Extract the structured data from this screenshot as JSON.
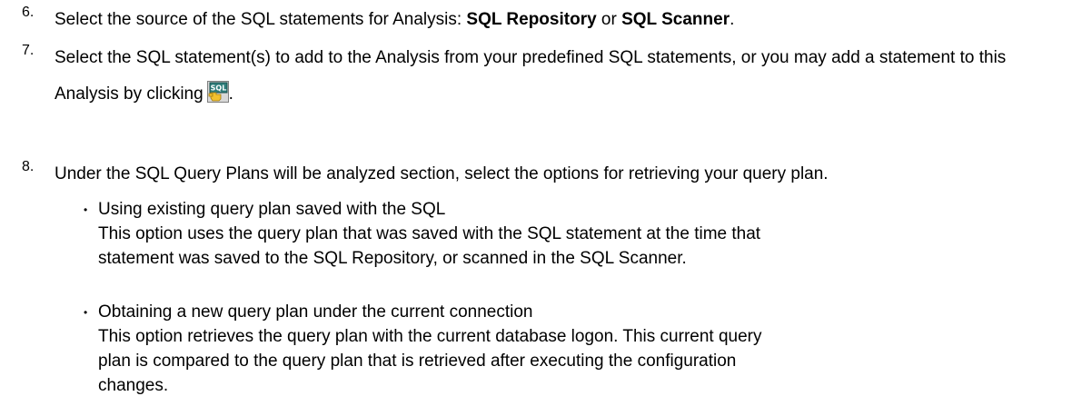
{
  "steps": [
    {
      "number": "6.",
      "text_before": "Select the source of the SQL statements for Analysis: ",
      "strong1": "SQL Repository",
      "middle": " or ",
      "strong2": "SQL Scanner",
      "text_after": "."
    },
    {
      "number": "7.",
      "text": "Select the SQL statement(s) to add to the Analysis from your predefined SQL statements, or you may add a statement to this Analysis by clicking",
      "button_icon": "add-sql-icon",
      "button_caption": "SQL",
      "text_after": "."
    },
    {
      "number": "8.",
      "text": "Under the SQL Query Plans will be analyzed section, select the options for retrieving your query plan."
    }
  ],
  "options": [
    {
      "bullet": "•",
      "title": "Using existing query plan saved with the SQL",
      "description": "This option uses the query plan that was saved with the SQL statement at the time that statement was saved to the SQL Repository, or scanned in the SQL Scanner."
    },
    {
      "bullet": "•",
      "title": "Obtaining a new query plan under the current connection",
      "description": "This option retrieves the query plan with the current database logon. This current query plan is compared to the query plan that is retrieved after executing the configuration changes."
    }
  ],
  "colors": {
    "text": "#000000",
    "icon_bg": "#2e7d7a",
    "icon_hand": "#f2c12e"
  }
}
